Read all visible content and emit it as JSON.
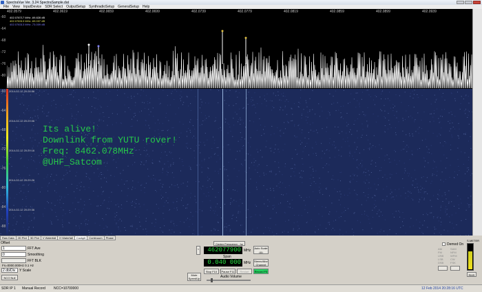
{
  "window": {
    "title": "SpectraVue Ver. 3.24  SpectraSample.dat"
  },
  "menu": [
    "File",
    "View",
    "InputDevice",
    "SDR Select",
    "OutputSetup",
    "SynthradioSetup",
    "GeneralSetup",
    "Help"
  ],
  "freq_axis": [
    "402.0579",
    "402.0619",
    "402.0659",
    "402.0699",
    "402.0739",
    "402.0779",
    "402.0819",
    "402.0859",
    "402.0899",
    "402.0939"
  ],
  "db_axis": [
    "-60",
    "-64",
    "-68",
    "-72",
    "-76",
    "-80"
  ],
  "wf_axis": [
    "-60",
    "-64",
    "-68",
    "-72",
    "-76",
    "-80",
    "-84",
    "-88"
  ],
  "legend": [
    "402.078717 MHz  -69.828 dB",
    "402.078313 MHz  -69.037 dB",
    "402.078313 MHz  -73.009 dB"
  ],
  "timestamps": [
    "2014-02-12 20:28:56",
    "2014-02-12 20:29:06",
    "2014-02-12 20:29:16",
    "2014-02-12 20:29:26",
    "2014-02-12 20:29:36"
  ],
  "overlay": [
    "Its alive!",
    "Downlink from YUTU rover!",
    "Freq: 8462.078MHz",
    "@UHF_Satcom"
  ],
  "tabs": [
    "Raw Data",
    "2D Plot",
    "3D Plot",
    "V Waterfall",
    "H Waterfall",
    "Cockpit",
    "Continuum",
    "Phase"
  ],
  "controls": {
    "offset_label": "Offset",
    "fft_ave_value": "1",
    "fft_ave_label": "FFT Ave",
    "smoothing_value": "0",
    "smoothing_label": "Smoothing",
    "fft_blk_label": "FFT BLK",
    "fs_text": "Fs=0000.000Hz 0.1 Hz",
    "yscale_value": "2 db/Div",
    "yscale_label": "Y Scale",
    "nco_null": "NCO Null",
    "center_freq_btn": "Center Frequency - hz",
    "center_freq_value": "462077900",
    "mhz_unit": "MHz",
    "span_label": "Span",
    "span_value": "0.040 000",
    "auto_scale": "Auto Scale (A)",
    "mono_channel": "Stereo/Mono Channel",
    "stop": "Stop F10",
    "pause": "Pause F11",
    "restart": "Restart",
    "record": "Record F5",
    "audio_volume": "Audio Volume",
    "mute": "Mute",
    "speedup": "SpeedUp",
    "demod_label": "Demod On",
    "demod_options": [
      "AM",
      "SAM",
      "FM",
      "NFM",
      "USB",
      "WFM",
      "LSB",
      "CW",
      "DSB",
      "FSK"
    ],
    "s_meter_label": "S-METER",
    "rms_label": "RMS"
  },
  "status": {
    "left": "SDR IP 1",
    "mode": "Manual Record",
    "ncc": "NCC=10700000",
    "right": "12 Feb 2014  20:28:16 UTC"
  },
  "colors": {
    "overlay_text": "#26c94a",
    "waterfall_bg": "#1c2a5a",
    "lcd_text": "#28e040"
  }
}
